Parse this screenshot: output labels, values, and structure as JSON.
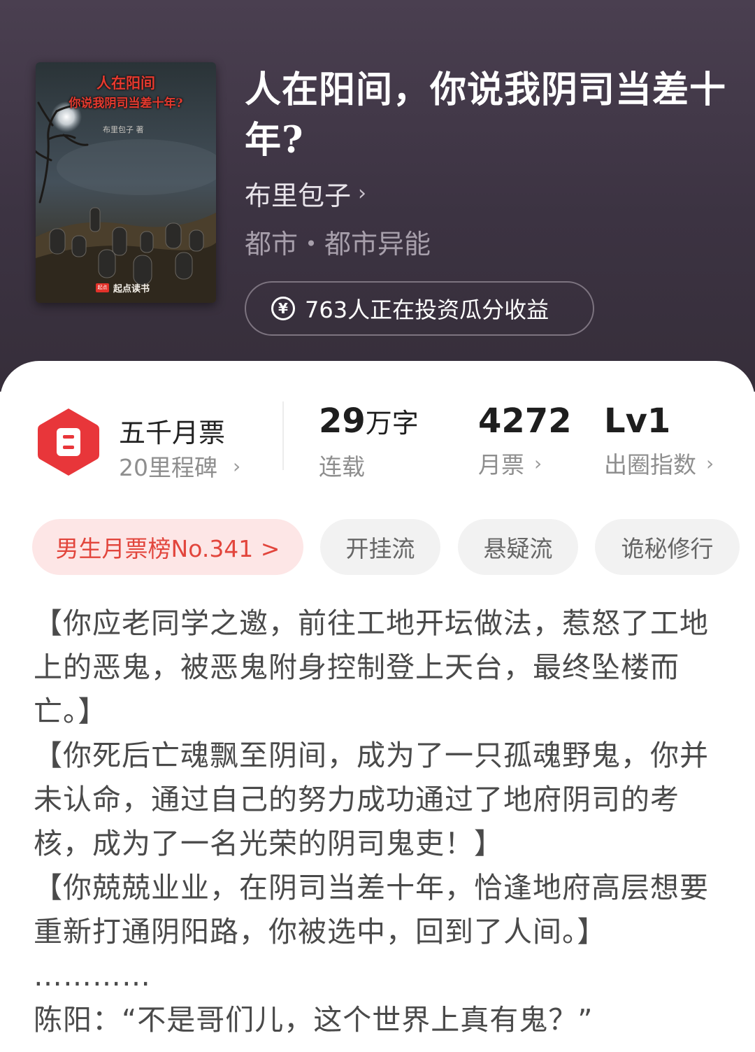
{
  "book": {
    "cover": {
      "title_line1": "人在阳间",
      "title_line2": "你说我阴司当差十年?",
      "author": "布里包子 著",
      "publisher_logo": "起点",
      "publisher": "起点读书"
    },
    "title": "人在阳间，你说我阴司当差十年?",
    "author": "布里包子",
    "genre": "都市・都市异能",
    "invest_text": "763人正在投资瓜分收益",
    "invest_icon": "yen-circle-icon",
    "invest_symbol": "¥"
  },
  "stats": {
    "ticket": {
      "title": "五千月票",
      "subtitle": "20里程碑",
      "badge_color": "#e8363a"
    },
    "words": {
      "value": "29",
      "unit": "万字",
      "label": "连载"
    },
    "monthly": {
      "value": "4272",
      "label": "月票"
    },
    "circle": {
      "value": "Lv1",
      "label": "出圈指数"
    }
  },
  "tags": {
    "rank": "男生月票榜No.341 >",
    "items": [
      "开挂流",
      "悬疑流",
      "诡秘修行"
    ]
  },
  "synopsis": [
    "【你应老同学之邀，前往工地开坛做法，惹怒了工地上的恶鬼，被恶鬼附身控制登上天台，最终坠楼而亡。】",
    "【你死后亡魂飘至阴间，成为了一只孤魂野鬼，你并未认命，通过自己的努力成功通过了地府阴司的考核，成为了一名光荣的阴司鬼吏！】",
    "【你兢兢业业，在阴司当差十年，恰逢地府高层想要重新打通阴阳路，你被选中，回到了人间。】",
    "…………",
    "陈阳：“不是哥们儿，这个世界上真有鬼？”"
  ]
}
